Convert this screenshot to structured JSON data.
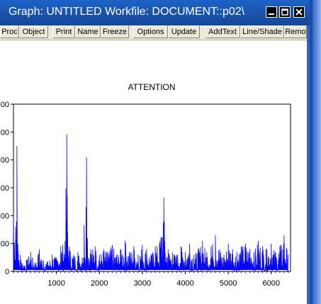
{
  "window": {
    "title": "Graph: UNTITLED   Workfile: DOCUMENT::p02\\",
    "accent_color": "#1a55ae"
  },
  "toolbar": {
    "buttons": [
      {
        "label": "Proc"
      },
      {
        "label": "Object"
      },
      {
        "label": "Print"
      },
      {
        "label": "Name"
      },
      {
        "label": "Freeze"
      },
      {
        "label": "Options"
      },
      {
        "label": "Update"
      },
      {
        "label": "AddText"
      },
      {
        "label": "Line/Shade"
      },
      {
        "label": "Remo"
      }
    ]
  },
  "chart_data": {
    "type": "line",
    "title": "ATTENTION",
    "xlabel": "",
    "ylabel": "",
    "x_ticks": [
      1000,
      2000,
      3000,
      4000,
      5000,
      6000
    ],
    "y_ticks_visible_suffix": [
      "00",
      "00",
      "00",
      "00",
      "00",
      "00",
      "0"
    ],
    "xlim": [
      0,
      6450
    ],
    "ylim": [
      0,
      600
    ],
    "line_color": "#0000ff",
    "grid": false,
    "series": [
      {
        "x": [
          0,
          50,
          80,
          100,
          130,
          160,
          200,
          300,
          400,
          500,
          600,
          700,
          800,
          900,
          1000,
          1100,
          1200,
          1240,
          1260,
          1300,
          1400,
          1500,
          1600,
          1700,
          1720,
          1800,
          1900,
          2000,
          2100,
          2200,
          2300,
          2400,
          2500,
          2600,
          2700,
          2800,
          2900,
          3000,
          3100,
          3200,
          3300,
          3400,
          3500,
          3520,
          3600,
          3700,
          3800,
          3900,
          4000,
          4100,
          4200,
          4300,
          4400,
          4500,
          4600,
          4700,
          4800,
          4900,
          5000,
          5100,
          5200,
          5300,
          5400,
          5500,
          5600,
          5700,
          5800,
          5900,
          6000,
          6100,
          6200,
          6300,
          6400
        ],
        "y": [
          200,
          160,
          450,
          100,
          40,
          60,
          30,
          40,
          70,
          30,
          80,
          40,
          35,
          60,
          50,
          90,
          110,
          490,
          140,
          90,
          60,
          70,
          50,
          410,
          120,
          80,
          90,
          60,
          80,
          70,
          95,
          60,
          80,
          110,
          70,
          90,
          60,
          95,
          80,
          60,
          90,
          100,
          265,
          110,
          80,
          70,
          60,
          90,
          70,
          100,
          60,
          80,
          110,
          70,
          90,
          130,
          80,
          60,
          100,
          80,
          70,
          90,
          100,
          80,
          70,
          110,
          90,
          80,
          100,
          70,
          90,
          130,
          60
        ]
      }
    ]
  }
}
